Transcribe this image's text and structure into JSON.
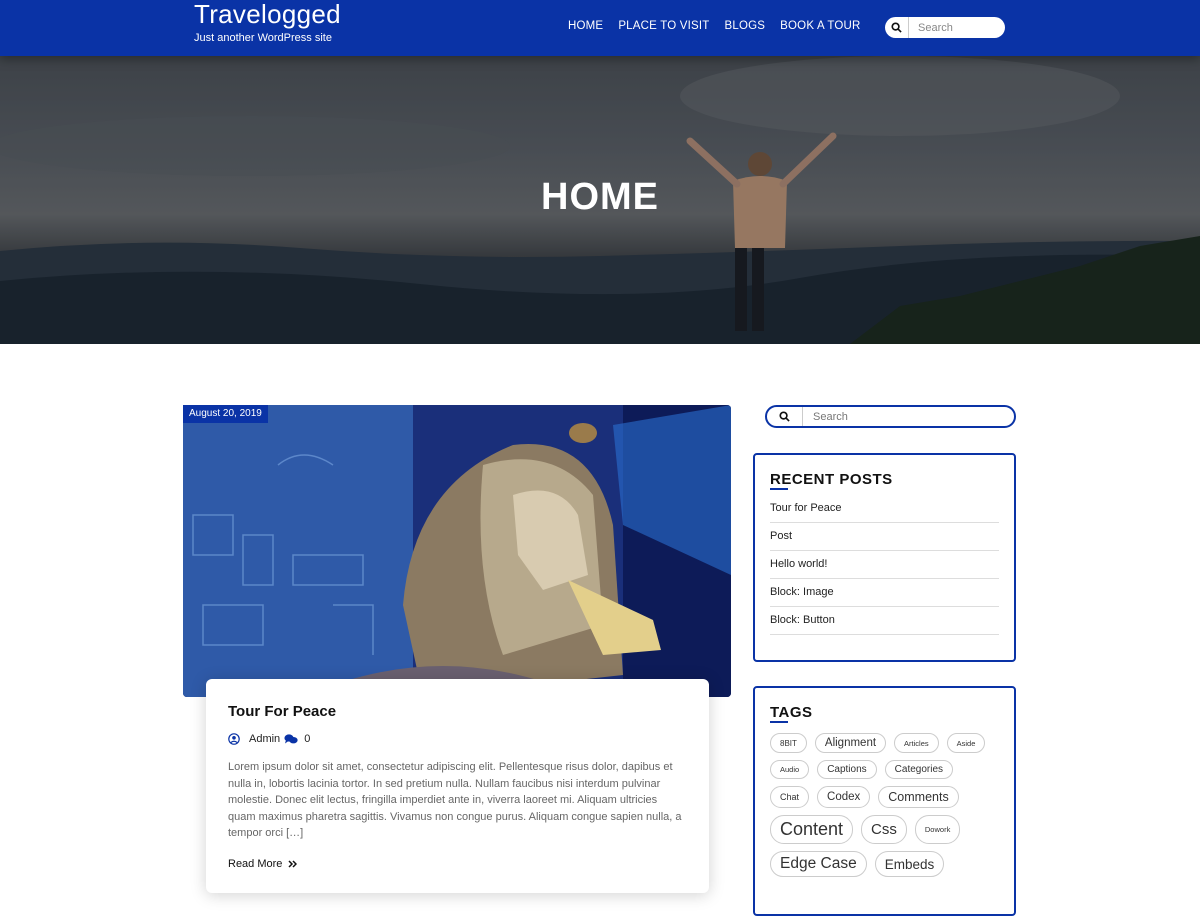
{
  "header": {
    "site_title": "Travelogged",
    "site_description": "Just another WordPress site",
    "nav": [
      "HOME",
      "PLACE TO VISIT",
      "BLOGS",
      "BOOK A TOUR"
    ],
    "search_placeholder": "Search"
  },
  "hero": {
    "title": "HOME"
  },
  "post": {
    "date": "August 20, 2019",
    "title": "Tour For Peace",
    "author": "Admin",
    "comments": "0",
    "excerpt": "Lorem ipsum dolor sit amet, consectetur adipiscing elit. Pellentesque risus dolor, dapibus et nulla in, lobortis lacinia tortor. In sed pretium nulla. Nullam faucibus nisi interdum pulvinar molestie. Donec elit lectus, fringilla imperdiet ante in, viverra laoreet mi. Aliquam ultricies quam maximus pharetra sagittis. Vivamus non congue purus. Aliquam congue sapien nulla, a tempor orci […]",
    "read_more": "Read More"
  },
  "sidebar": {
    "search_placeholder": "Search",
    "recent_posts": {
      "title": "RECENT POSTS",
      "items": [
        "Tour for Peace",
        "Post",
        "Hello world!",
        "Block: Image",
        "Block: Button"
      ]
    },
    "tags": {
      "title": "TAGS",
      "items": [
        {
          "label": "8BIT",
          "size": 8
        },
        {
          "label": "Alignment",
          "size": 11.5
        },
        {
          "label": "Articles",
          "size": 7.5
        },
        {
          "label": "Aside",
          "size": 7.5
        },
        {
          "label": "Audio",
          "size": 7.5
        },
        {
          "label": "Captions",
          "size": 10
        },
        {
          "label": "Categories",
          "size": 10
        },
        {
          "label": "Chat",
          "size": 9
        },
        {
          "label": "Codex",
          "size": 11.5
        },
        {
          "label": "Comments",
          "size": 12.5
        },
        {
          "label": "Content",
          "size": 18
        },
        {
          "label": "Css",
          "size": 15
        },
        {
          "label": "Dowork",
          "size": 7.5
        },
        {
          "label": "Edge Case",
          "size": 15.5
        },
        {
          "label": "Embeds",
          "size": 13.5
        }
      ]
    }
  },
  "colors": {
    "brand": "#0a33a6"
  }
}
